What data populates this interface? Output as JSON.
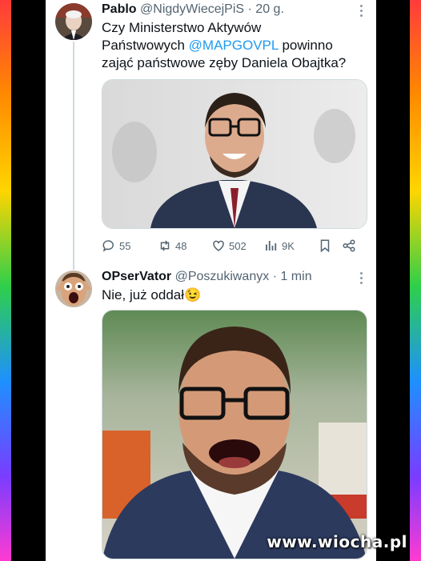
{
  "tweet1": {
    "name": "Pablo",
    "handle": "@NigdyWiecejPiS",
    "time": "· 20 g.",
    "text_line1": "Czy Ministerstwo Aktywów",
    "text_line2_pre": "Państwowych ",
    "mention": "@MAPGOVPL",
    "text_line2_post": " powinno",
    "text_line3": "zająć państwowe zęby Daniela Obajtka?",
    "stats": {
      "replies": "55",
      "reposts": "48",
      "likes": "502",
      "views": "9K"
    }
  },
  "tweet2": {
    "name": "OPserVator",
    "handle": "@Poszukiwanyx",
    "time": "· 1 min",
    "text": "Nie, już oddał😉"
  },
  "watermark": "www.wiocha.pl",
  "colors": {
    "accent": "#1d9bf0",
    "text": "#0f1419",
    "muted": "#536471"
  },
  "icons": [
    "more-icon",
    "reply-icon",
    "repost-icon",
    "like-icon",
    "views-icon",
    "bookmark-icon",
    "share-icon"
  ]
}
